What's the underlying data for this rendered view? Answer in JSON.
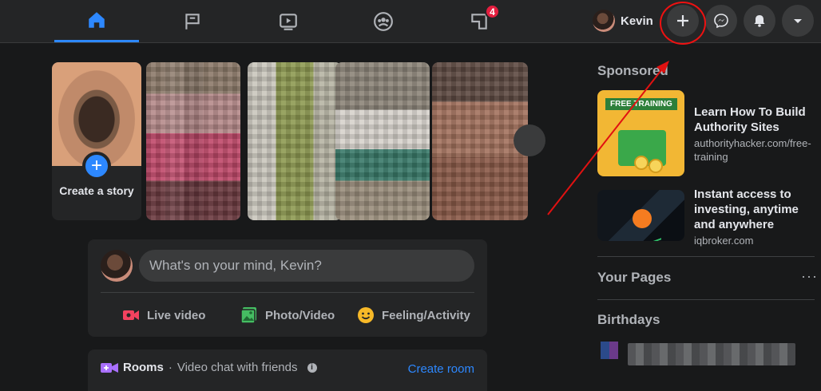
{
  "nav": {
    "tabs": [
      {
        "name": "home",
        "active": true
      },
      {
        "name": "pages"
      },
      {
        "name": "watch"
      },
      {
        "name": "groups"
      },
      {
        "name": "gaming",
        "badge": "4"
      }
    ],
    "profile_name": "Kevin",
    "buttons": [
      "create",
      "messenger",
      "notifications",
      "account"
    ]
  },
  "stories": {
    "create_label": "Create a story"
  },
  "composer": {
    "placeholder": "What's on your mind, Kevin?",
    "actions": {
      "live": "Live video",
      "photo": "Photo/Video",
      "feeling": "Feeling/Activity"
    }
  },
  "rooms": {
    "title": "Rooms",
    "separator": "·",
    "subtitle": "Video chat with friends",
    "info": "i",
    "create": "Create room"
  },
  "right": {
    "sponsored_title": "Sponsored",
    "ads": [
      {
        "headline": "Learn How To Build Authority Sites",
        "url": "authorityhacker.com/free-training",
        "thumb_text": "FREE TRAINING"
      },
      {
        "headline": "Instant access to investing, anytime and anywhere",
        "url": "iqbroker.com"
      }
    ],
    "your_pages_title": "Your Pages",
    "pages_more": "···",
    "birthdays_title": "Birthdays"
  },
  "colors": {
    "accent": "#2d88ff",
    "annotation": "#e11111",
    "badge": "#e41e3f"
  }
}
